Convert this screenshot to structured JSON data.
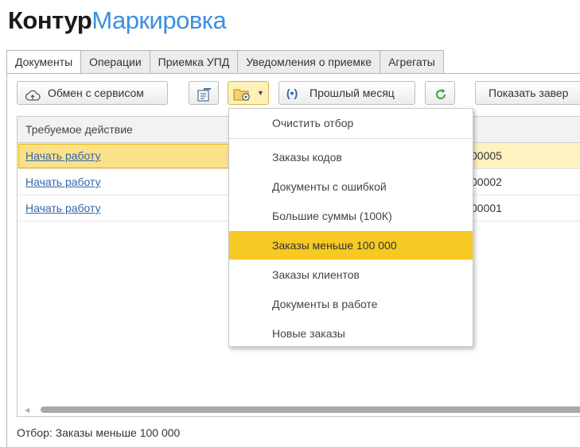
{
  "logo": {
    "brand": "Контур",
    "product": "Маркировка"
  },
  "tabs": [
    "Документы",
    "Операции",
    "Приемка УПД",
    "Уведомления о приемке",
    "Агрегаты"
  ],
  "toolbar": {
    "exchange_label": "Обмен с сервисом",
    "period_label": "Прошлый месяц",
    "show_completed_label": "Показать завер"
  },
  "grid": {
    "header": "Требуемое действие",
    "rows": [
      {
        "action": "Начать работу",
        "number": "00005"
      },
      {
        "action": "Начать работу",
        "number": "00002"
      },
      {
        "action": "Начать работу",
        "number": "00001"
      }
    ]
  },
  "filter_menu": {
    "clear_label": "Очистить отбор",
    "items": [
      "Заказы кодов",
      "Документы с ошибкой",
      "Большие суммы (100К)",
      "Заказы меньше 100 000",
      "Заказы клиентов",
      "Документы в работе",
      "Новые заказы"
    ],
    "highlighted": "Заказы меньше 100 000"
  },
  "status": {
    "filter_text": "Отбор: Заказы меньше 100 000"
  },
  "colors": {
    "accent_blue": "#3d8fe0",
    "highlight_yellow": "#f6c924",
    "row_selected": "#fdf2c0",
    "refresh_green": "#3aa03a"
  }
}
